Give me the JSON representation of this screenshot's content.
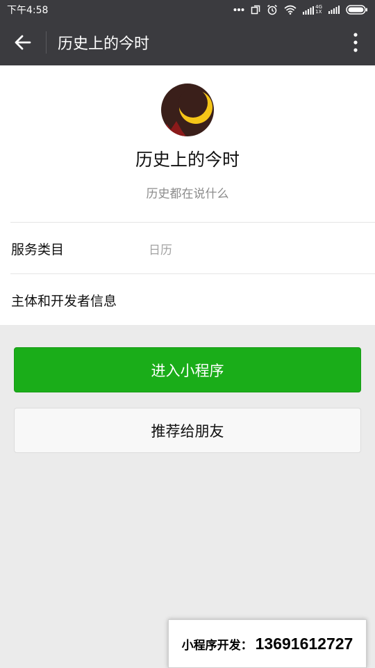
{
  "status_bar": {
    "time": "下午4:58",
    "network_label_top": "4G",
    "network_label_bottom": "1X"
  },
  "nav": {
    "title": "历史上的今时",
    "back_icon": "arrow-left-icon",
    "more_icon": "more-vertical-icon"
  },
  "profile": {
    "name": "历史上的今时",
    "description": "历史都在说什么",
    "avatar_colors": {
      "bg": "#3a1f1a",
      "moon": "#f5c518",
      "accent": "#8b1a1a"
    }
  },
  "info_rows": [
    {
      "label": "服务类目",
      "value": "日历"
    },
    {
      "label": "主体和开发者信息",
      "value": ""
    }
  ],
  "buttons": {
    "enter_label": "进入小程序",
    "share_label": "推荐给朋友"
  },
  "promo": {
    "label": "小程序开发：",
    "phone": "13691612727"
  },
  "colors": {
    "bar": "#3b3b3f",
    "primary": "#1aad19",
    "page_bg": "#ebebeb"
  }
}
